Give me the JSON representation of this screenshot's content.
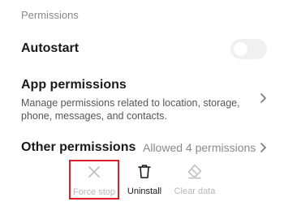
{
  "section": {
    "label": "Permissions"
  },
  "autostart": {
    "title": "Autostart",
    "enabled": false
  },
  "app_permissions": {
    "title": "App permissions",
    "description": "Manage permissions related to location, storage, phone, messages, and contacts."
  },
  "other_permissions": {
    "title": "Other permissions",
    "value": "Allowed 4 permissions"
  },
  "actions": {
    "force_stop": {
      "label": "Force stop",
      "icon": "close-icon",
      "disabled": true
    },
    "uninstall": {
      "label": "Uninstall",
      "icon": "trash-icon",
      "disabled": false
    },
    "clear_data": {
      "label": "Clear data",
      "icon": "eraser-icon",
      "disabled": true
    }
  },
  "colors": {
    "highlight_border": "#d9202a",
    "disabled_text": "#b8b8b8",
    "secondary_text": "#8a8a8a"
  }
}
